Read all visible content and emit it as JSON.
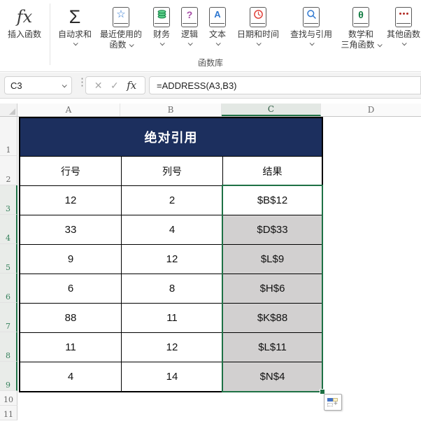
{
  "ribbon": {
    "group_label": "函数库",
    "buttons": [
      {
        "label": "插入函数",
        "icon": "insert-function"
      },
      {
        "label": "自动求和",
        "icon": "autosum"
      },
      {
        "label_line1": "最近使用的",
        "label_line2": "函数",
        "icon": "recently-used"
      },
      {
        "label": "财务",
        "icon": "financial"
      },
      {
        "label": "逻辑",
        "icon": "logical"
      },
      {
        "label": "文本",
        "icon": "text"
      },
      {
        "label": "日期和时间",
        "icon": "date-time"
      },
      {
        "label": "查找与引用",
        "icon": "lookup-reference"
      },
      {
        "label_line1": "数学和",
        "label_line2": "三角函数",
        "icon": "math-trig"
      },
      {
        "label": "其他函数",
        "icon": "more-functions"
      }
    ]
  },
  "formula_bar": {
    "name_box": "C3",
    "formula": "=ADDRESS(A3,B3)"
  },
  "grid": {
    "column_headers": [
      "A",
      "B",
      "C",
      "D"
    ],
    "selected_column": "C",
    "row_headers": [
      "1",
      "2",
      "3",
      "4",
      "5",
      "6",
      "7",
      "8",
      "9",
      "10",
      "11"
    ],
    "selected_rows": [
      "3",
      "4",
      "5",
      "6",
      "7",
      "8",
      "9"
    ],
    "active_cell": "C3",
    "selected_range": "C3:C9"
  },
  "table": {
    "title": "绝对引用",
    "headers": [
      "行号",
      "列号",
      "结果"
    ],
    "rows": [
      [
        "12",
        "2",
        "$B$12"
      ],
      [
        "33",
        "4",
        "$D$33"
      ],
      [
        "9",
        "12",
        "$L$9"
      ],
      [
        "6",
        "8",
        "$H$6"
      ],
      [
        "88",
        "11",
        "$K$88"
      ],
      [
        "11",
        "12",
        "$L$11"
      ],
      [
        "4",
        "14",
        "$N$4"
      ]
    ]
  },
  "colors": {
    "title_navy": "#1c2f5e",
    "selection_green": "#1e7145",
    "selection_fill_gray": "#d2d0d0",
    "icon_blue": "#2e77d0",
    "icon_green": "#107c41",
    "icon_red": "#e0433c",
    "icon_purple": "#a64ca6"
  }
}
